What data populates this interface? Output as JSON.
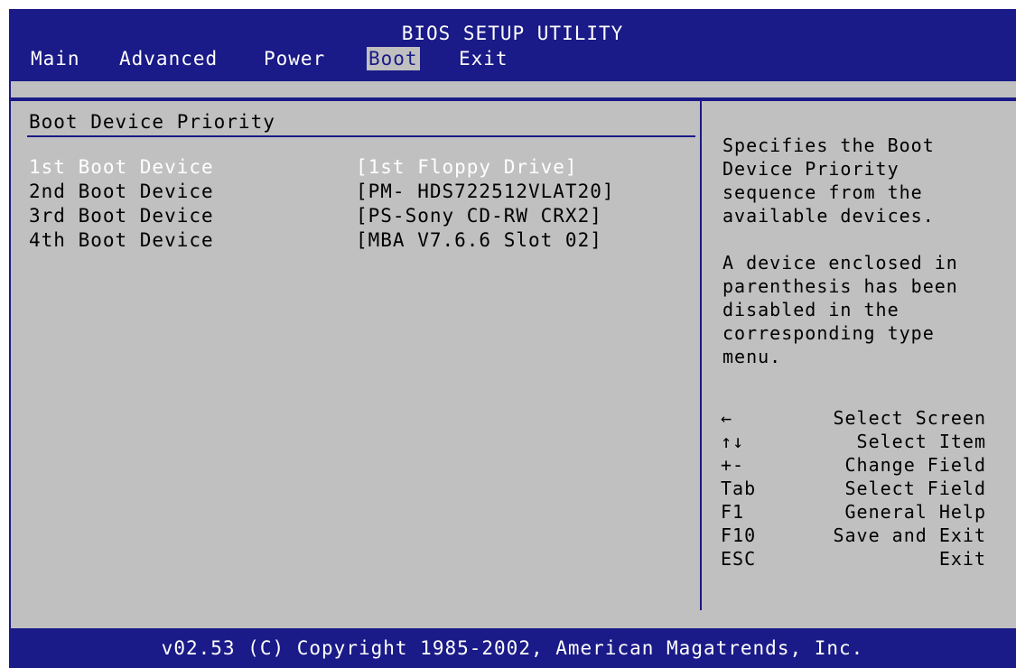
{
  "header": {
    "title": "BIOS SETUP UTILITY",
    "menu": [
      "Main",
      "Advanced",
      "Power",
      "Boot",
      "Exit"
    ],
    "active_menu": "Boot"
  },
  "main": {
    "section_title": "Boot Device Priority",
    "devices": [
      {
        "label": "1st Boot Device",
        "value": "[1st Floppy Drive]",
        "selected": true
      },
      {
        "label": "2nd Boot Device",
        "value": "[PM- HDS722512VLAT20]",
        "selected": false
      },
      {
        "label": "3rd Boot Device",
        "value": "[PS-Sony CD-RW CRX2]",
        "selected": false
      },
      {
        "label": "4th Boot Device",
        "value": "[MBA V7.6.6 Slot 02]",
        "selected": false
      }
    ]
  },
  "help": {
    "text": "Specifies the Boot\nDevice Priority\nsequence from the\navailable devices.\n\nA device enclosed in\nparenthesis has been\ndisabled in the\ncorresponding type\nmenu."
  },
  "keys": [
    {
      "key": "←",
      "desc": "Select Screen"
    },
    {
      "key": "↑↓",
      "desc": "Select Item"
    },
    {
      "key": "+-",
      "desc": "Change Field"
    },
    {
      "key": "Tab",
      "desc": "Select Field"
    },
    {
      "key": "F1",
      "desc": "General Help"
    },
    {
      "key": "F10",
      "desc": "Save and Exit"
    },
    {
      "key": "ESC",
      "desc": "Exit"
    }
  ],
  "footer": {
    "copyright": "v02.53 (C) Copyright 1985-2002, American Magatrends, Inc."
  },
  "colors": {
    "background_blue": "#1a1a88",
    "panel_gray": "#c0c0c0",
    "selected_text": "#ffffff"
  }
}
